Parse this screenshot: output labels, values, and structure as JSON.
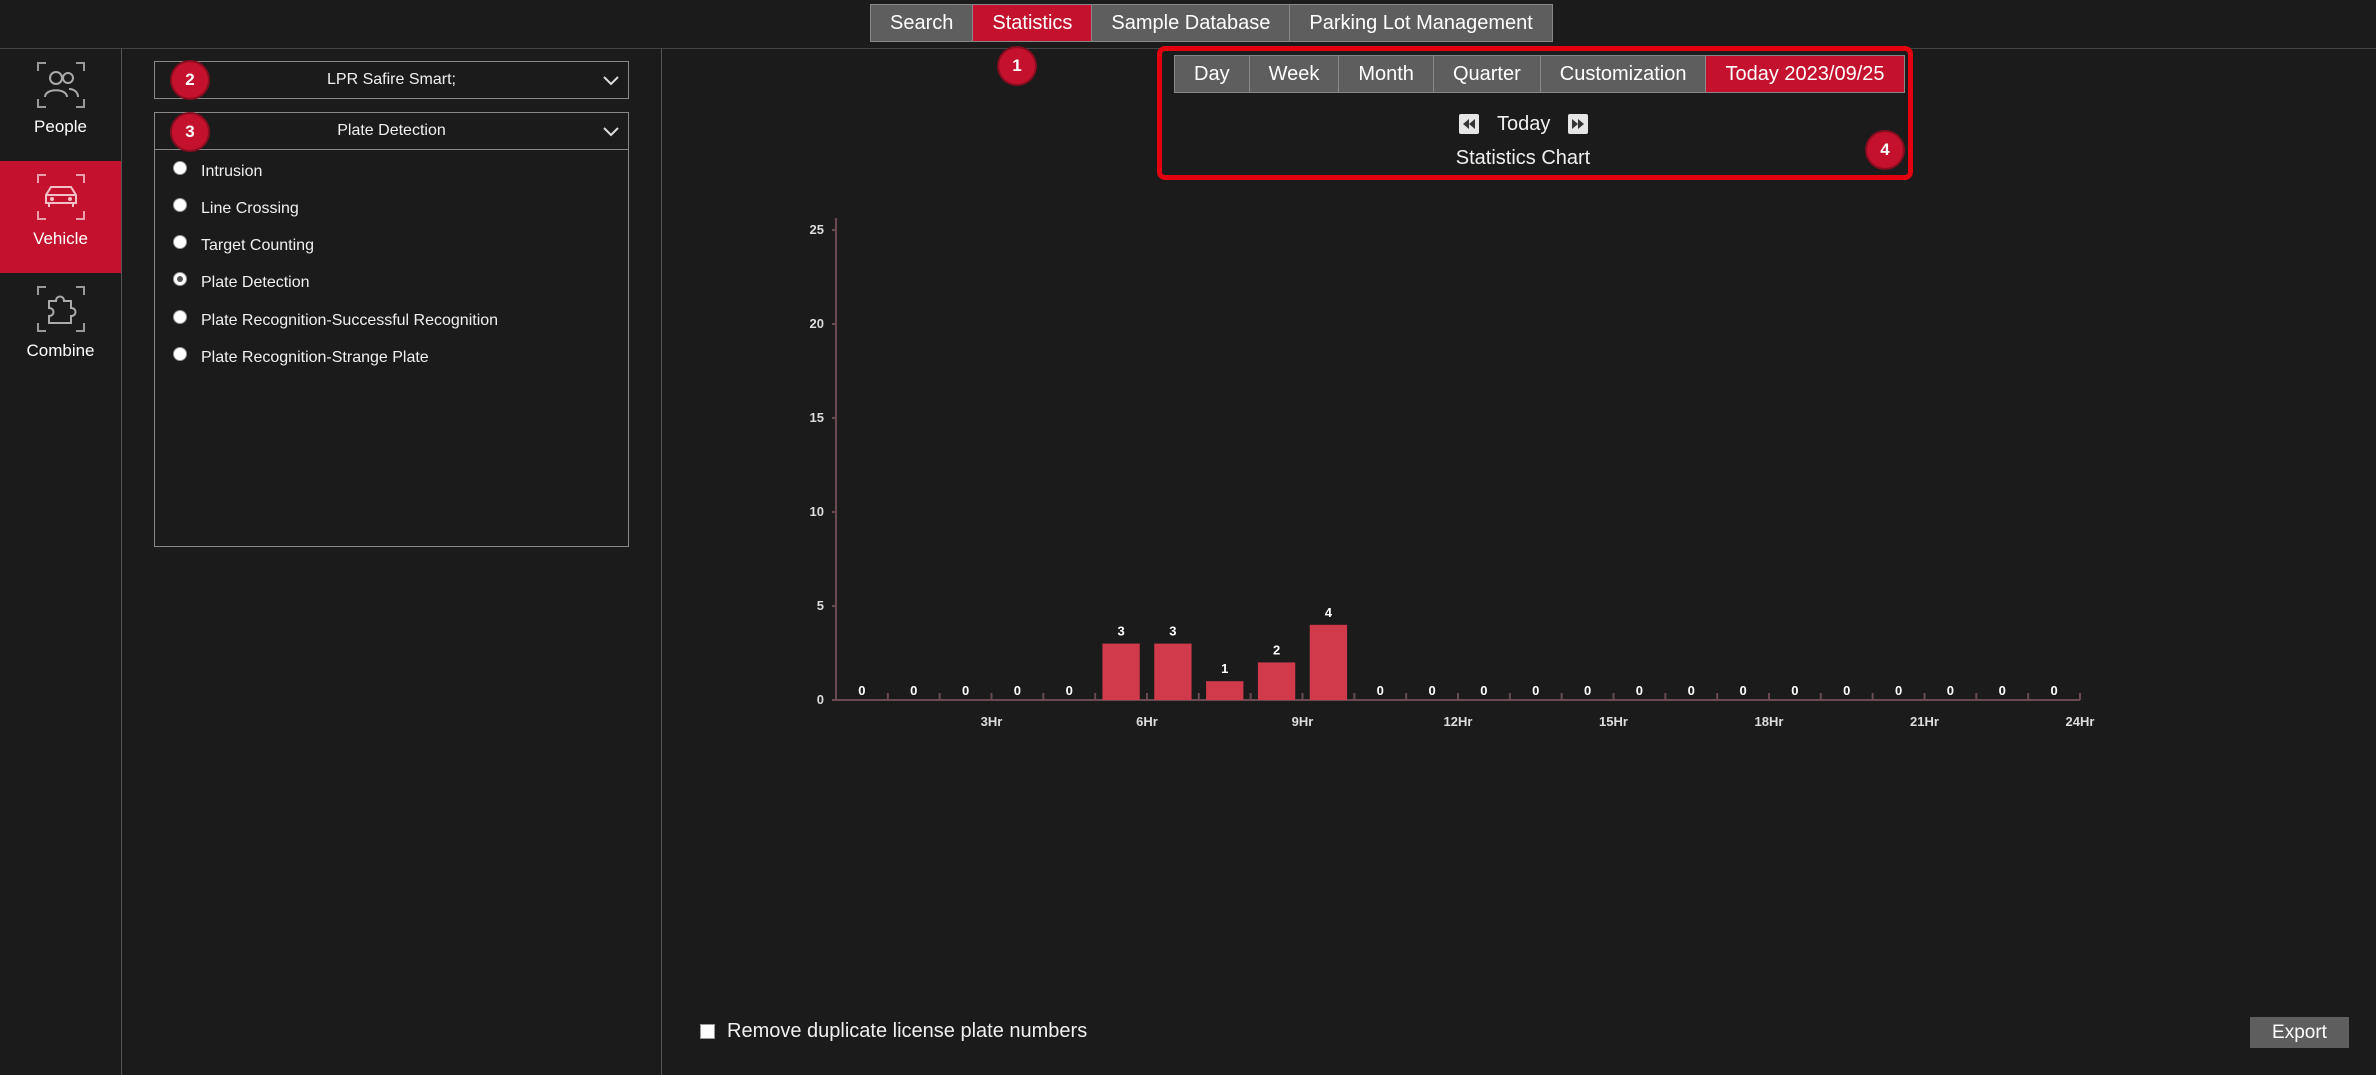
{
  "top_tabs": [
    "Search",
    "Statistics",
    "Sample Database",
    "Parking Lot Management"
  ],
  "top_tab_active_index": 1,
  "sidebar": {
    "items": [
      {
        "label": "People",
        "icon": "people-icon"
      },
      {
        "label": "Vehicle",
        "icon": "vehicle-icon"
      },
      {
        "label": "Combine",
        "icon": "puzzle-icon"
      }
    ],
    "active_index": 1
  },
  "filters": {
    "device_select": "LPR Safire Smart;",
    "event_select": "Plate Detection",
    "event_options": [
      "Intrusion",
      "Line Crossing",
      "Target Counting",
      "Plate Detection",
      "Plate Recognition-Successful Recognition",
      "Plate Recognition-Strange Plate"
    ],
    "selected_option_index": 3
  },
  "badges": [
    "1",
    "2",
    "3",
    "4"
  ],
  "period": {
    "tabs": [
      "Day",
      "Week",
      "Month",
      "Quarter",
      "Customization",
      "Today 2023/09/25"
    ],
    "active_index": 5,
    "nav_label": "Today",
    "chart_title": "Statistics Chart"
  },
  "chart_data": {
    "type": "bar",
    "title": "Statistics Chart",
    "xlabel": "",
    "ylabel": "",
    "ylim": [
      0,
      25
    ],
    "y_ticks": [
      0,
      5,
      10,
      15,
      20,
      25
    ],
    "x_tick_labels": [
      "3Hr",
      "6Hr",
      "9Hr",
      "12Hr",
      "15Hr",
      "18Hr",
      "21Hr",
      "24Hr"
    ],
    "x_range_hours": [
      0,
      24
    ],
    "values": [
      0,
      0,
      0,
      0,
      0,
      3,
      3,
      1,
      2,
      4,
      0,
      0,
      0,
      0,
      0,
      0,
      0,
      0,
      0,
      0,
      0,
      0,
      0,
      0
    ],
    "grid": false,
    "bar_color": "#d03a4a"
  },
  "bottom": {
    "dedupe_label": "Remove duplicate license plate numbers",
    "export_label": "Export"
  },
  "colors": {
    "accent": "#c4112d",
    "highlight": "#e3000f",
    "background": "#1b1b1b"
  }
}
